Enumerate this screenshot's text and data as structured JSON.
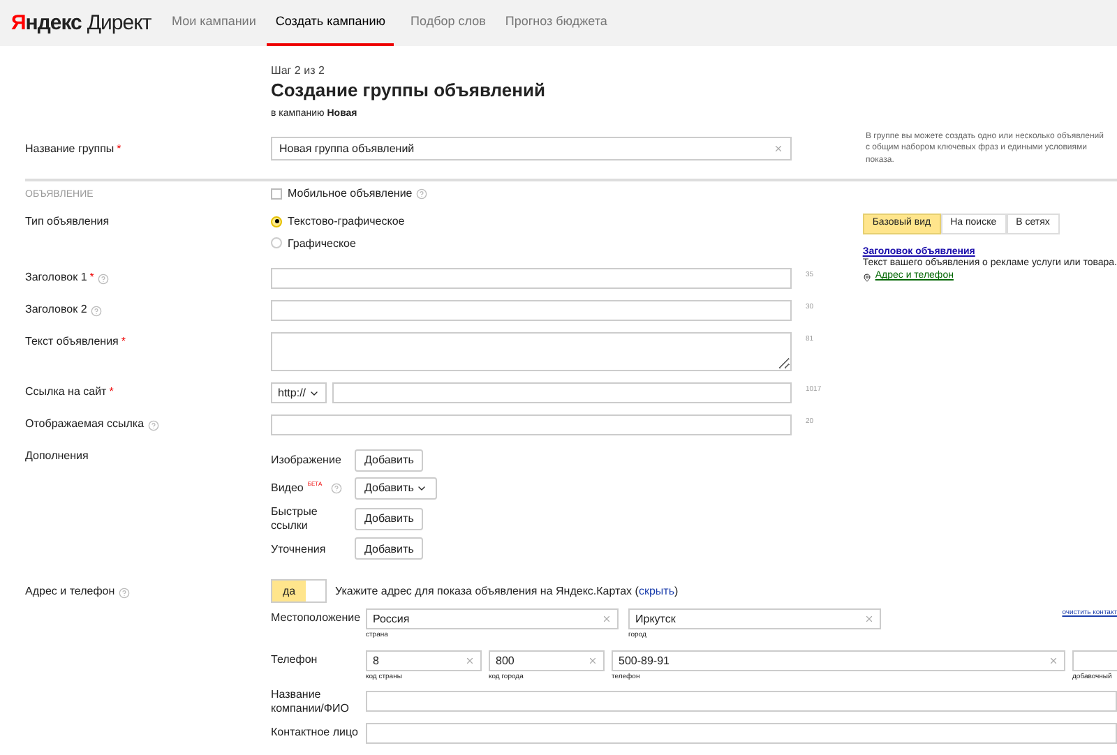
{
  "header": {
    "logo": {
      "first": "Я",
      "rest": "ндекс",
      "product": "Директ"
    },
    "nav": [
      {
        "label": "Мои кампании",
        "selected": false
      },
      {
        "label": "Создать кампанию",
        "selected": true
      },
      {
        "label": "Подбор слов",
        "selected": false
      },
      {
        "label": "Прогноз бюджета",
        "selected": false
      }
    ]
  },
  "page": {
    "step": "Шаг 2 из 2",
    "title": "Создание группы объявлений",
    "campaign": "в кампанию **Новая**"
  },
  "group_name": {
    "label": "Название группы",
    "required": "*",
    "value": "Новая группа объявлений",
    "hint": "В группе вы можете создать одно или несколько объявлений с общим набором ключевых фраз и едиными условиями показа."
  },
  "ad_section": {
    "label": "ОБЪЯВЛЕНИЕ",
    "mobile": {
      "label": "Мобильное объявление",
      "checked": false,
      "help": true
    }
  },
  "ad_type": {
    "label": "Тип объявления",
    "options": [
      {
        "label": "Текстово-графическое",
        "selected": true
      },
      {
        "label": "Графическое",
        "selected": false
      }
    ]
  },
  "fields": [
    {
      "kind": "input",
      "label": "Заголовок 1",
      "required": "*",
      "help": true,
      "counter": "35"
    },
    {
      "kind": "input",
      "label": "Заголовок 2",
      "help": true,
      "counter": "30"
    },
    {
      "kind": "textarea",
      "label": "Текст объявления",
      "required": "*",
      "help": false,
      "counter": "81"
    },
    {
      "kind": "url",
      "label": "Ссылка на сайт",
      "required": "*",
      "help": false,
      "protocol": "http://",
      "counter": "1017"
    },
    {
      "kind": "input",
      "label": "Отображаемая ссылка",
      "help": true,
      "counter": "20"
    }
  ],
  "extras": {
    "label": "Дополнения",
    "items": [
      {
        "label": "Изображение",
        "button": "Добавить",
        "dropdown": false,
        "help": false
      },
      {
        "label": "Видео",
        "beta": "БЕТА",
        "button": "Добавить",
        "dropdown": true,
        "help": true
      },
      {
        "label": "Быстрые ссылки",
        "button": "Добавить",
        "dropdown": false,
        "help": false
      },
      {
        "label": "Уточнения",
        "button": "Добавить",
        "dropdown": false,
        "help": false
      }
    ]
  },
  "preview": {
    "tabs": [
      {
        "label": "Базовый вид",
        "selected": true
      },
      {
        "label": "На поиске",
        "selected": false
      },
      {
        "label": "В сетях",
        "selected": false
      }
    ],
    "title": "Заголовок объявления",
    "text": "Текст вашего объявления о рекламе услуги или товара.",
    "address_link": "Адрес и телефон"
  },
  "address": {
    "label": "Адрес и телефон",
    "help": true,
    "toggle": {
      "label": "да",
      "on": true
    },
    "note": "Укажите адрес для показа объявления на Яндекс.Картах",
    "link_open": "(",
    "link": "скрыть",
    "link_close": ")",
    "location": {
      "label": "Местоположение",
      "fields": [
        {
          "value": "Россия",
          "caption": "страна"
        },
        {
          "value": "Иркутск",
          "caption": "город"
        }
      ],
      "clear_link": "очистить контакт"
    },
    "phone": {
      "label": "Телефон",
      "fields": [
        {
          "value": "8",
          "caption": "код страны"
        },
        {
          "value": "800",
          "caption": "код города"
        },
        {
          "value": "500-89-91",
          "caption": "телефон"
        },
        {
          "caption": "добавочный"
        }
      ]
    },
    "company": {
      "label": "Название компании/ФИО"
    },
    "contact": {
      "label": "Контактное лицо"
    }
  }
}
